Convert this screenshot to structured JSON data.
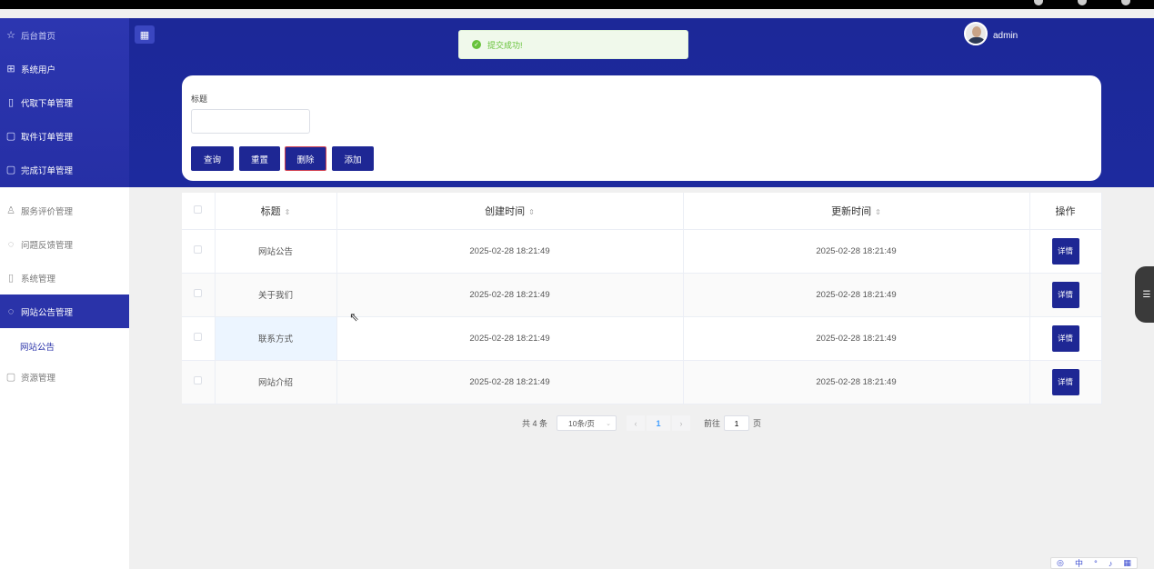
{
  "topbar": {
    "tiny_text": ""
  },
  "sidebar": {
    "items": [
      {
        "label": "后台首页",
        "icon": "star-icon"
      },
      {
        "label": "系统用户",
        "icon": "grid-icon"
      },
      {
        "label": "代取下单管理",
        "icon": "clipboard-icon"
      },
      {
        "label": "取件订单管理",
        "icon": "order-icon"
      },
      {
        "label": "完成订单管理",
        "icon": "order-done-icon"
      },
      {
        "label": "服务评价管理",
        "icon": "user-icon"
      },
      {
        "label": "问题反馈管理",
        "icon": "chat-icon"
      },
      {
        "label": "系统管理",
        "icon": "clipboard-icon"
      },
      {
        "label": "网站公告管理",
        "icon": "chat-icon"
      },
      {
        "label": "资源管理",
        "icon": "file-icon"
      }
    ],
    "sub_item": "网站公告"
  },
  "header": {
    "system_title": "",
    "username": "admin"
  },
  "toast": {
    "message": "提交成功!"
  },
  "search": {
    "label": "标题",
    "value": "",
    "buttons": {
      "query": "查询",
      "reset": "重置",
      "delete": "删除",
      "add": "添加"
    }
  },
  "table": {
    "headers": {
      "title": "标题",
      "created": "创建时间",
      "updated": "更新时间",
      "action": "操作"
    },
    "sort_icon": "⇕",
    "rows": [
      {
        "title": "网站公告",
        "created": "2025-02-28 18:21:49",
        "updated": "2025-02-28 18:21:49",
        "action": "详情"
      },
      {
        "title": "关于我们",
        "created": "2025-02-28 18:21:49",
        "updated": "2025-02-28 18:21:49",
        "action": "详情"
      },
      {
        "title": "联系方式",
        "created": "2025-02-28 18:21:49",
        "updated": "2025-02-28 18:21:49",
        "action": "详情"
      },
      {
        "title": "网站介绍",
        "created": "2025-02-28 18:21:49",
        "updated": "2025-02-28 18:21:49",
        "action": "详情"
      }
    ]
  },
  "pagination": {
    "total": "共 4 条",
    "page_size": "10条/页",
    "current_page": "1",
    "goto_label": "前往",
    "goto_value": "1",
    "page_suffix": "页"
  },
  "ime": {
    "label": "中"
  },
  "colors": {
    "primary": "#1e2794",
    "sidebar_active": "#2a33a9",
    "success": "#67c23a"
  }
}
